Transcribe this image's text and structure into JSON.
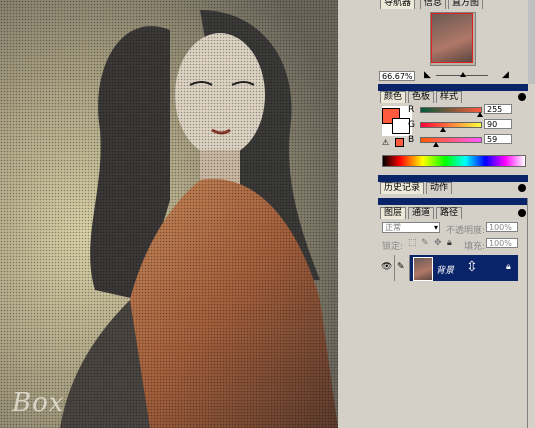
{
  "navigator": {
    "tabs": [
      "导航器",
      "信息",
      "直方图"
    ],
    "zoom": "66.67%"
  },
  "color": {
    "tabs": [
      "颜色",
      "色板",
      "样式"
    ],
    "channels": [
      {
        "label": "R",
        "value": "255"
      },
      {
        "label": "G",
        "value": "90"
      },
      {
        "label": "B",
        "value": "59"
      }
    ],
    "foreground": "#ff5a3b"
  },
  "history": {
    "tabs": [
      "历史记录",
      "动作"
    ]
  },
  "layers": {
    "tabs": [
      "图层",
      "通道",
      "路径"
    ],
    "blend_mode": "正常",
    "opacity_label": "不透明度:",
    "opacity_value": "100%",
    "lock_label": "锁定:",
    "fill_label": "填充:",
    "fill_value": "100%",
    "layer_name": "背景"
  },
  "canvas": {
    "watermark": "Box"
  }
}
